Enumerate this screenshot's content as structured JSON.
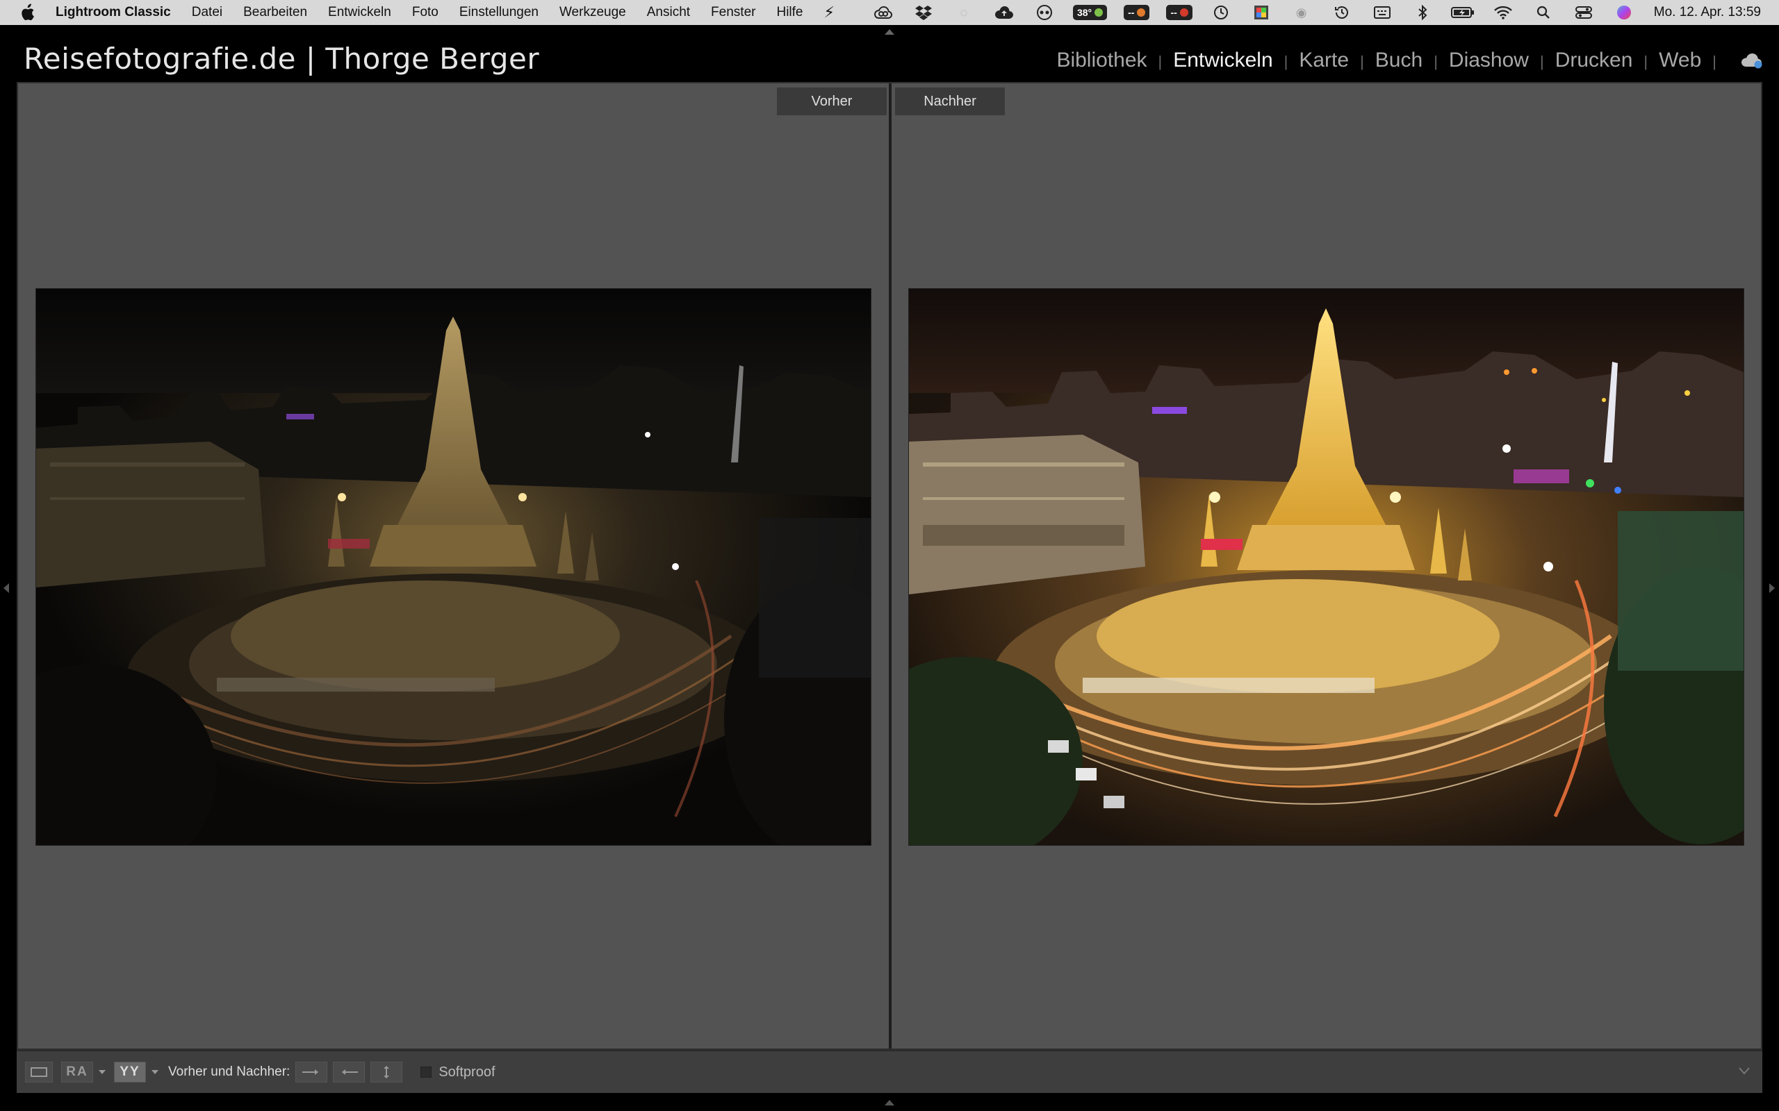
{
  "menubar": {
    "app": "Lightroom Classic",
    "items": [
      "Datei",
      "Bearbeiten",
      "Entwickeln",
      "Foto",
      "Einstellungen",
      "Werkzeuge",
      "Ansicht",
      "Fenster",
      "Hilfe"
    ],
    "temp_badge": "38°",
    "badge2": "--",
    "badge3": "--",
    "clock": "Mo. 12. Apr.  13:59"
  },
  "identity_plate": "Reisefotografie.de | Thorge Berger",
  "modules": [
    {
      "label": "Bibliothek",
      "active": false
    },
    {
      "label": "Entwickeln",
      "active": true
    },
    {
      "label": "Karte",
      "active": false
    },
    {
      "label": "Buch",
      "active": false
    },
    {
      "label": "Diashow",
      "active": false
    },
    {
      "label": "Drucken",
      "active": false
    },
    {
      "label": "Web",
      "active": false
    }
  ],
  "compare": {
    "before_label": "Vorher",
    "after_label": "Nachher"
  },
  "toolbar": {
    "ra_label": "RA",
    "yy_label": "YY",
    "before_after_label": "Vorher und Nachher:",
    "softproof_label": "Softproof",
    "softproof_checked": false
  }
}
